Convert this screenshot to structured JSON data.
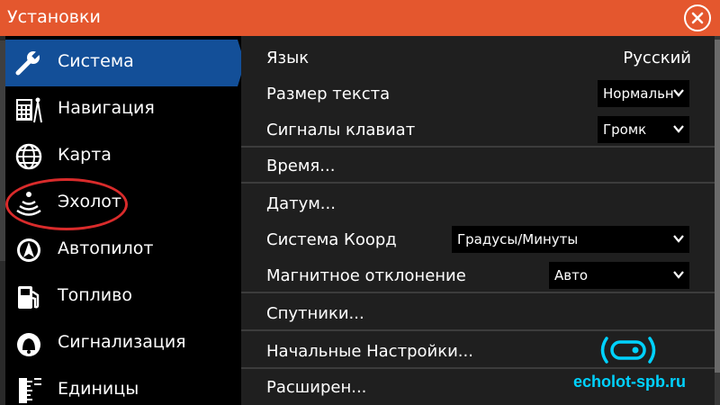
{
  "window": {
    "title": "Установки"
  },
  "sidebar": {
    "items": [
      {
        "label": "Система",
        "icon": "wrench-icon",
        "active": true
      },
      {
        "label": "Навигация",
        "icon": "calculator-compass-icon"
      },
      {
        "label": "Карта",
        "icon": "globe-icon"
      },
      {
        "label": "Эхолот",
        "icon": "sonar-icon"
      },
      {
        "label": "Автопилот",
        "icon": "autopilot-icon"
      },
      {
        "label": "Топливо",
        "icon": "fuel-pump-icon"
      },
      {
        "label": "Сигнализация",
        "icon": "alarm-bell-icon"
      },
      {
        "label": "Единицы",
        "icon": "ruler-icon"
      }
    ]
  },
  "settings": {
    "language": {
      "label": "Язык",
      "value": "Русский"
    },
    "text_size": {
      "label": "Размер текста",
      "value": "Нормальн"
    },
    "key_beeps": {
      "label": "Сигналы клавиат",
      "value": "Громк"
    },
    "time": {
      "label": "Время..."
    },
    "datum": {
      "label": "Датум..."
    },
    "coord_system": {
      "label": "Система Коорд",
      "value": "Градусы/Минуты"
    },
    "mag_variation": {
      "label": "Магнитное отклонение",
      "value": "Авто"
    },
    "satellites": {
      "label": "Спутники..."
    },
    "factory_defaults": {
      "label": "Начальные Настройки..."
    },
    "advanced": {
      "label": "Расширен..."
    }
  },
  "watermark": {
    "text": "echolot-spb.ru"
  },
  "colors": {
    "titlebar": "#e4572e",
    "active_item": "#134f98",
    "panel": "#1f1f1f",
    "watermark": "#00d2ff",
    "annotation": "#d92b2b"
  }
}
